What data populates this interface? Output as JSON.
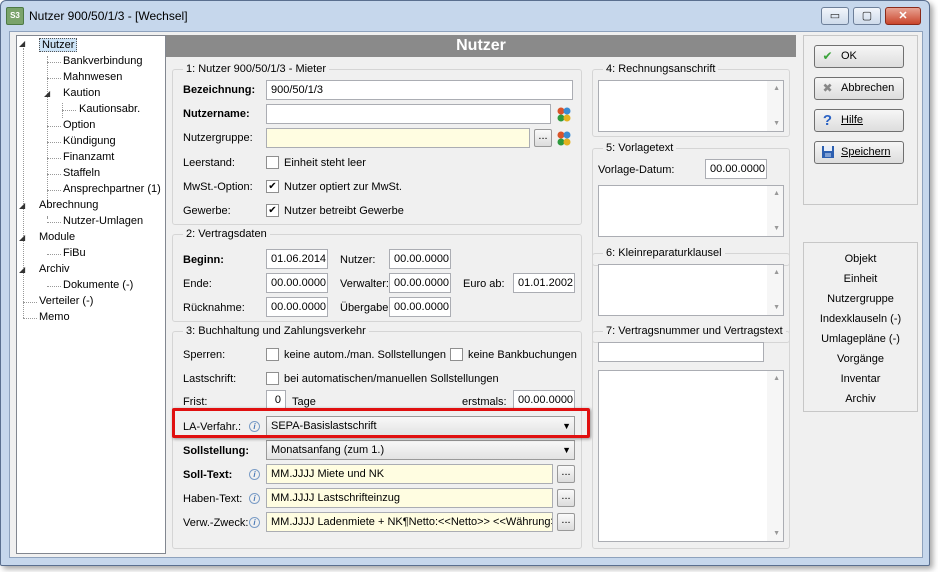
{
  "window": {
    "title": "Nutzer 900/50/1/3 - [Wechsel]",
    "app_icon_text": "S3",
    "controls": {
      "minimize": "▭",
      "maximize": "▢",
      "close": "✕"
    }
  },
  "tree": {
    "items": [
      {
        "label": "Nutzer"
      },
      {
        "label": "Bankverbindung"
      },
      {
        "label": "Mahnwesen"
      },
      {
        "label": "Kaution"
      },
      {
        "label": "Kautionsabr."
      },
      {
        "label": "Option"
      },
      {
        "label": "Kündigung"
      },
      {
        "label": "Finanzamt"
      },
      {
        "label": "Staffeln"
      },
      {
        "label": "Ansprechpartner (1)"
      },
      {
        "label": "Abrechnung"
      },
      {
        "label": "Nutzer-Umlagen"
      },
      {
        "label": "Module"
      },
      {
        "label": "FiBu"
      },
      {
        "label": "Archiv"
      },
      {
        "label": "Dokumente (-)"
      },
      {
        "label": "Verteiler (-)"
      },
      {
        "label": "Memo"
      }
    ]
  },
  "header": {
    "title": "Nutzer"
  },
  "group1": {
    "title": "1: Nutzer 900/50/1/3 - Mieter",
    "bezeichnung_label": "Bezeichnung:",
    "bezeichnung_value": "900/50/1/3",
    "nutzername_label": "Nutzername:",
    "nutzername_value": "",
    "nutzergruppe_label": "Nutzergruppe:",
    "nutzergruppe_value": "",
    "dots": "...",
    "leerstand_label": "Leerstand:",
    "leerstand_cb_label": "Einheit steht leer",
    "leerstand_checked": false,
    "mwst_label": "MwSt.-Option:",
    "mwst_cb_label": "Nutzer optiert zur MwSt.",
    "mwst_checked": true,
    "gewerbe_label": "Gewerbe:",
    "gewerbe_cb_label": "Nutzer betreibt Gewerbe",
    "gewerbe_checked": true
  },
  "group2": {
    "title": "2: Vertragsdaten",
    "beginn_label": "Beginn:",
    "beginn_value": "01.06.2014",
    "nutzer_label": "Nutzer:",
    "nutzer_value": "00.00.0000",
    "ende_label": "Ende:",
    "ende_value": "00.00.0000",
    "verwalter_label": "Verwalter:",
    "verwalter_value": "00.00.0000",
    "euro_label": "Euro ab:",
    "euro_value": "01.01.2002",
    "ruecknahme_label": "Rücknahme:",
    "ruecknahme_value": "00.00.0000",
    "uebergabe_label": "Übergabe:",
    "uebergabe_value": "00.00.0000"
  },
  "group3": {
    "title": "3: Buchhaltung und Zahlungsverkehr",
    "sperren_label": "Sperren:",
    "sperren_cb1": "keine autom./man. Sollstellungen",
    "sperren_cb2": "keine Bankbuchungen",
    "lastschrift_label": "Lastschrift:",
    "lastschrift_cb": "bei automatischen/manuellen Sollstellungen",
    "frist_label": "Frist:",
    "frist_value": "0",
    "tage_label": "Tage",
    "erstmals_label": "erstmals:",
    "erstmals_value": "00.00.0000",
    "la_label": "LA-Verfahr.:",
    "la_value": "SEPA-Basislastschrift",
    "soll_label": "Sollstellung:",
    "soll_value": "Monatsanfang (zum 1.)",
    "solltext_label": "Soll-Text:",
    "solltext_value": "MM.JJJJ Miete und NK",
    "habentext_label": "Haben-Text:",
    "habentext_value": "MM.JJJJ Lastschrifteinzug",
    "verwzweck_label": "Verw.-Zweck:",
    "verwzweck_value": "MM.JJJJ Ladenmiete + NK¶Netto:<<Netto>> <<Währung>>",
    "info_glyph": "i",
    "dots": "..."
  },
  "group4": {
    "title": "4: Rechnungsanschrift"
  },
  "group5": {
    "title": "5: Vorlagetext",
    "datum_label": "Vorlage-Datum:",
    "datum_value": "00.00.0000"
  },
  "group6": {
    "title": "6: Kleinreparaturklausel"
  },
  "group7": {
    "title": "7: Vertragsnummer und Vertragstext",
    "nummer_value": ""
  },
  "actions": {
    "ok": "OK",
    "abbrechen": "Abbrechen",
    "hilfe": "Hilfe",
    "speichern": "Speichern"
  },
  "links": [
    "Objekt",
    "Einheit",
    "Nutzergruppe",
    "Indexklauseln (-)",
    "Umlagepläne (-)",
    "Vorgänge",
    "Inventar",
    "Archiv"
  ],
  "colors": {
    "highlight": "#e01010",
    "header_bg": "#8a8a8a",
    "yellow_field": "#fffde1"
  }
}
